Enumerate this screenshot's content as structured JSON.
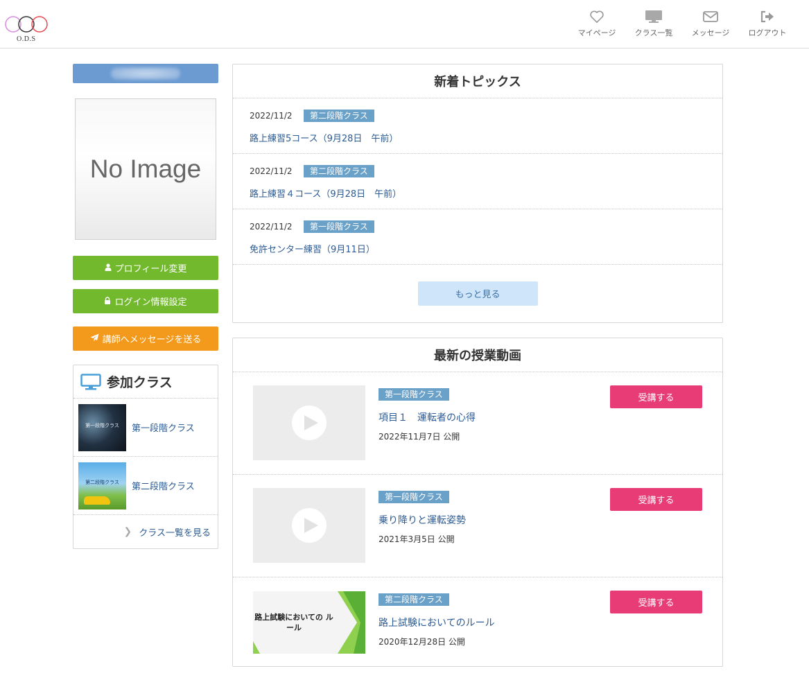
{
  "header": {
    "logo_text": "O.D.S",
    "nav": [
      {
        "label": "マイページ",
        "icon": "heart-icon"
      },
      {
        "label": "クラス一覧",
        "icon": "monitor-icon"
      },
      {
        "label": "メッセージ",
        "icon": "envelope-icon"
      },
      {
        "label": "ログアウト",
        "icon": "sign-out-icon"
      }
    ]
  },
  "sidebar": {
    "profile_image_text": "No Image",
    "buttons": {
      "profile_edit": "プロフィール変更",
      "login_settings": "ログイン情報設定",
      "message_instructor": "講師へメッセージを送る"
    },
    "classes": {
      "title": "参加クラス",
      "items": [
        {
          "label": "第一段階クラス",
          "thumb_text": "第一段階クラス"
        },
        {
          "label": "第二段階クラス",
          "thumb_text": "第二段階クラス"
        }
      ],
      "view_all": "クラス一覧を見る"
    }
  },
  "topics": {
    "title": "新着トピックス",
    "items": [
      {
        "date": "2022/11/2",
        "badge": "第二段階クラス",
        "title": "路上練習5コース（9月28日　午前）"
      },
      {
        "date": "2022/11/2",
        "badge": "第二段階クラス",
        "title": "路上練習４コース（9月28日　午前）"
      },
      {
        "date": "2022/11/2",
        "badge": "第一段階クラス",
        "title": "免許センター練習（9月11日）"
      }
    ],
    "more": "もっと見る"
  },
  "videos": {
    "title": "最新の授業動画",
    "items": [
      {
        "badge": "第一段階クラス",
        "title": "項目１　運転者の心得",
        "date": "2022年11月7日 公開",
        "button": "受講する"
      },
      {
        "badge": "第一段階クラス",
        "title": "乗り降りと運転姿勢",
        "date": "2021年3月5日 公開",
        "button": "受講する"
      },
      {
        "badge": "第二段階クラス",
        "title": "路上試験においてのルール",
        "date": "2020年12月28日 公開",
        "button": "受講する",
        "thumb_text": "路上試験においての ルール"
      }
    ]
  },
  "colors": {
    "name_bar": "#6b9bd1",
    "green_button": "#72b92d",
    "orange_button": "#f39a1d",
    "badge": "#6aa1c9",
    "enroll_button": "#e73c76",
    "more_button": "#cfe6fa",
    "link": "#2b5a93"
  }
}
